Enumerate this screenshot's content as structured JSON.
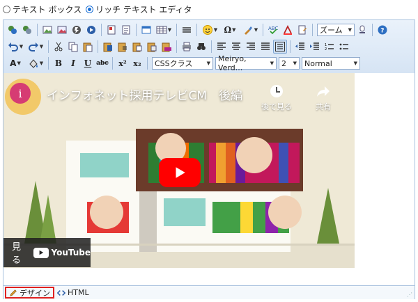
{
  "mode": {
    "options": [
      {
        "label": "テキスト ボックス",
        "checked": false
      },
      {
        "label": "リッチ テキスト エディタ",
        "checked": true
      }
    ]
  },
  "toolbar": {
    "zoom": "ズーム",
    "css_class": "CSSクラス",
    "font_name": "Meiryo, Verd...",
    "font_size": "2",
    "paragraph": "Normal",
    "bold": "B",
    "italic": "I",
    "underline": "U",
    "strike": "abc",
    "superscript": "x²",
    "subscript": "x₂"
  },
  "video": {
    "title": "インフォネット採用テレビCM　後編",
    "channel_icon": "i",
    "watch_later": "後で見る",
    "share": "共有",
    "watch_on": "見る",
    "youtube": "YouTube"
  },
  "footer": {
    "design_tab": "デザイン",
    "html_tab": "HTML"
  },
  "colors": {
    "toolbar_bg": "#dbe7f5",
    "border": "#a9c2df",
    "play_red": "#ff0000",
    "active_tab_border": "#e02020"
  }
}
